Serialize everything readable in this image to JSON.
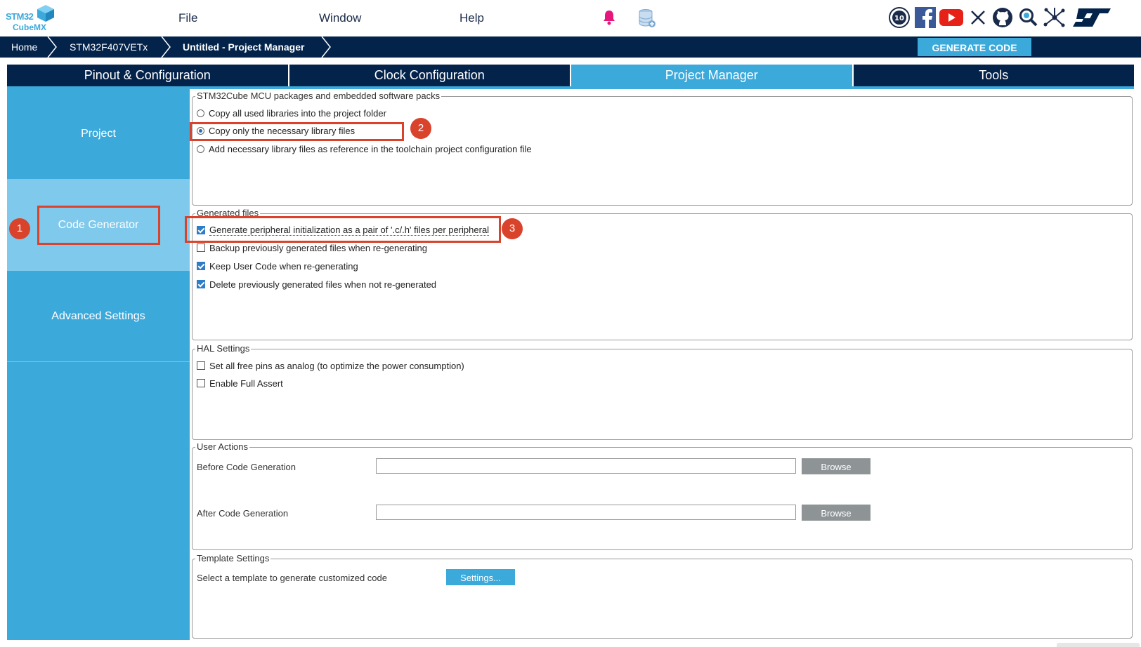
{
  "app": {
    "logo_line1": "STM32",
    "logo_line2": "CubeMX"
  },
  "menu": {
    "file": "File",
    "window": "Window",
    "help": "Help"
  },
  "toolbar_icons": [
    "bell-icon",
    "database-icon"
  ],
  "social_icons": [
    "anniversary-10-icon",
    "facebook-icon",
    "youtube-icon",
    "x-icon",
    "github-icon",
    "community-search-icon",
    "network-icon",
    "st-logo-icon"
  ],
  "breadcrumb": {
    "home": "Home",
    "device": "STM32F407VETx",
    "current": "Untitled - Project Manager"
  },
  "generate_button": "GENERATE CODE",
  "tabs": [
    "Pinout & Configuration",
    "Clock Configuration",
    "Project Manager",
    "Tools"
  ],
  "active_tab": "Project Manager",
  "left_nav": {
    "project": "Project",
    "code_generator": "Code Generator",
    "advanced": "Advanced Settings"
  },
  "packs": {
    "title": "STM32Cube MCU packages and embedded software packs",
    "opt1": "Copy all used libraries into the project folder",
    "opt2": "Copy only the necessary library files",
    "opt3": "Add necessary library files as reference in the toolchain project configuration file",
    "selected": 2
  },
  "generated": {
    "title": "Generated files",
    "opt1": "Generate peripheral initialization as a pair of '.c/.h' files per peripheral",
    "opt2": "Backup previously generated files when re-generating",
    "opt3": "Keep User Code when re-generating",
    "opt4": "Delete previously generated files when not re-generated",
    "checked": [
      true,
      false,
      true,
      true
    ]
  },
  "hal": {
    "title": "HAL Settings",
    "opt1": "Set all free pins as analog (to optimize the power consumption)",
    "opt2": "Enable Full Assert",
    "checked": [
      false,
      false
    ]
  },
  "user_actions": {
    "title": "User Actions",
    "before_label": "Before Code Generation",
    "before_value": "",
    "after_label": "After Code Generation",
    "after_value": "",
    "browse": "Browse"
  },
  "template": {
    "title": "Template Settings",
    "label": "Select a template to generate customized code",
    "button": "Settings..."
  },
  "annotations": {
    "step1": "1",
    "step2": "2",
    "step3": "3"
  },
  "colors": {
    "navy": "#03234b",
    "accent": "#3ca9db",
    "highlight": "#d9422b"
  }
}
